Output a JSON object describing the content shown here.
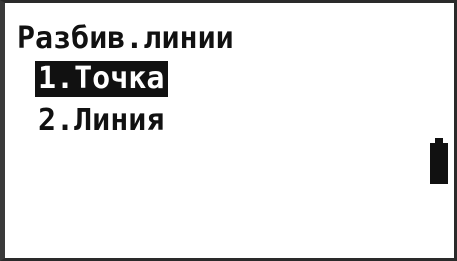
{
  "screen": {
    "title": "Разбив.линии",
    "menu": {
      "items": [
        {
          "label": "1.Точка",
          "selected": true
        },
        {
          "label": "2.Линия",
          "selected": false
        }
      ]
    },
    "battery": {
      "icon": "battery-full-icon"
    }
  }
}
